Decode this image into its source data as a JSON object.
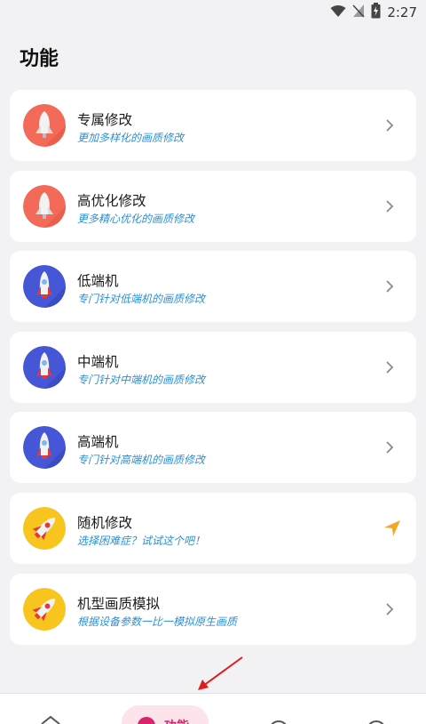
{
  "status_bar": {
    "time": "2:27"
  },
  "page": {
    "title": "功能"
  },
  "cards": [
    {
      "title": "专属修改",
      "subtitle": "更加多样化的画质修改",
      "icon": "rocket-coral-icon",
      "action_icon": "chevron-right-icon"
    },
    {
      "title": "高优化修改",
      "subtitle": "更多精心优化的画质修改",
      "icon": "rocket-coral-icon",
      "action_icon": "chevron-right-icon"
    },
    {
      "title": "低端机",
      "subtitle": "专门针对低端机的画质修改",
      "icon": "rocket-blue-icon",
      "action_icon": "chevron-right-icon"
    },
    {
      "title": "中端机",
      "subtitle": "专门针对中端机的画质修改",
      "icon": "rocket-blue-icon",
      "action_icon": "chevron-right-icon"
    },
    {
      "title": "高端机",
      "subtitle": "专门针对高端机的画质修改",
      "icon": "rocket-blue-icon",
      "action_icon": "chevron-right-icon"
    },
    {
      "title": "随机修改",
      "subtitle": "选择困难症？试试这个吧！",
      "icon": "rocket-yellow-icon",
      "action_icon": "send-arrow-icon"
    },
    {
      "title": "机型画质模拟",
      "subtitle": "根据设备参数一比一模拟原生画质",
      "icon": "rocket-yellow-icon",
      "action_icon": "chevron-right-icon"
    }
  ],
  "bottom_nav": {
    "items": [
      {
        "icon": "home-icon"
      },
      {
        "icon": "function-icon",
        "label": "功能",
        "active": true
      },
      {
        "icon": "info-icon"
      },
      {
        "icon": "profile-icon"
      }
    ]
  },
  "colors": {
    "accent": "#d8246b",
    "subtitle": "#2a8fd6",
    "background": "#f2f2f4",
    "card": "#ffffff"
  }
}
